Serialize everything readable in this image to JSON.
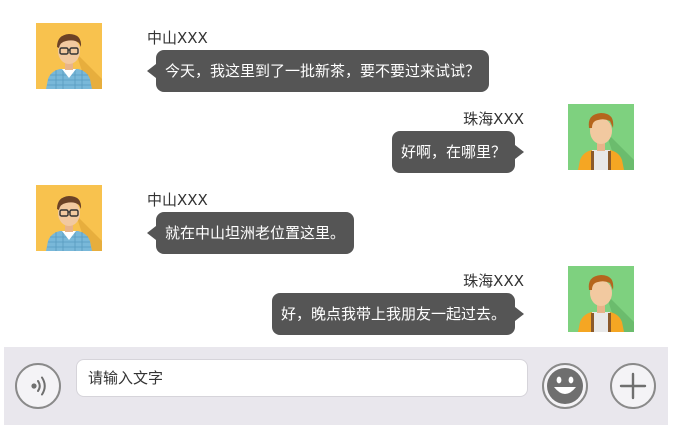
{
  "colors": {
    "bubble": "#555555",
    "bubble_text": "#ffffff",
    "input_bar": "#e9e7ed",
    "avatar_a_bg": "#f8c24e",
    "avatar_b_bg": "#7ed17f"
  },
  "messages": [
    {
      "side": "left",
      "sender": "中山XXX",
      "text": "今天，我这里到了一批新茶，要不要过来试试？",
      "avatar": "man-with-glasses-avatar"
    },
    {
      "side": "right",
      "sender": "珠海XXX",
      "text": "好啊，在哪里？",
      "avatar": "man-with-suspenders-avatar"
    },
    {
      "side": "left",
      "sender": "中山XXX",
      "text": "就在中山坦洲老位置这里。",
      "avatar": "man-with-glasses-avatar"
    },
    {
      "side": "right",
      "sender": "珠海XXX",
      "text": "好，晚点我带上我朋友一起过去。",
      "avatar": "man-with-suspenders-avatar"
    }
  ],
  "input_bar": {
    "placeholder": "请输入文字",
    "voice_icon": "voice-icon",
    "emoji_icon": "smiley-icon",
    "plus_icon": "plus-icon"
  }
}
